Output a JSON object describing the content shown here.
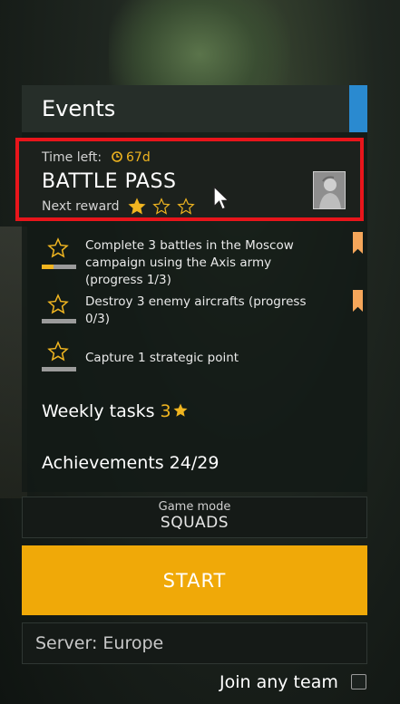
{
  "events": {
    "title": "Events"
  },
  "battle_pass": {
    "time_left_label": "Time left:",
    "time_left_value": "67d",
    "title": "BATTLE PASS",
    "next_reward_label": "Next reward",
    "stars_filled": 1,
    "stars_total": 3
  },
  "tasks": [
    {
      "text": "Complete 3 battles in the Moscow campaign using the Axis army (progress 1/3)",
      "progress": 0.33
    },
    {
      "text": "Destroy 3 enemy aircrafts (progress 0/3)",
      "progress": 0
    },
    {
      "text": "Capture 1 strategic point",
      "progress": 0
    }
  ],
  "weekly": {
    "label": "Weekly tasks",
    "count": "3"
  },
  "achievements": {
    "label": "Achievements 24/29"
  },
  "game_mode": {
    "label": "Game mode",
    "value": "SQUADS"
  },
  "start": {
    "label": "START"
  },
  "server": {
    "label": "Server: Europe"
  },
  "join_team": {
    "label": "Join any team",
    "checked": false
  },
  "colors": {
    "accent_blue": "#2a8ad0",
    "highlight_red": "#e8151b",
    "gold": "#f0b520",
    "start_orange": "#f0a908"
  }
}
